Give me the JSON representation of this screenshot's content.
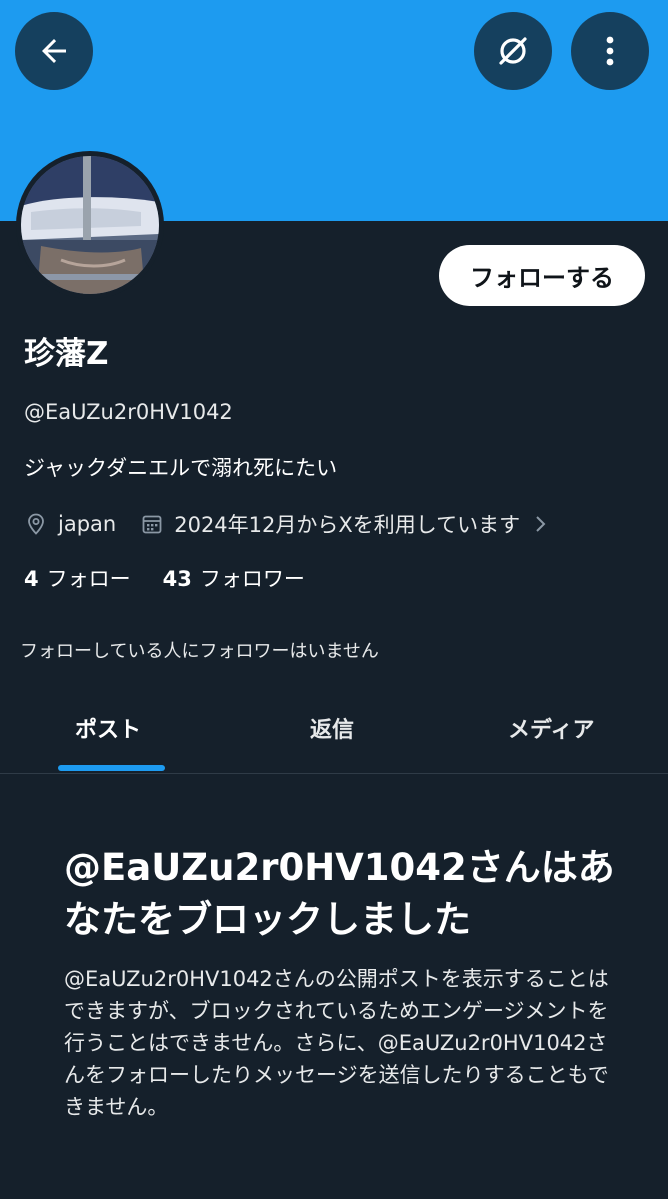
{
  "profile": {
    "display_name": "珍藩Z",
    "handle": "@EaUZu2r0HV1042",
    "bio": "ジャックダニエルで溺れ死にたい",
    "location": "japan",
    "joined": "2024年12月からXを利用しています",
    "following_count": "4",
    "following_label": "フォロー",
    "followers_count": "43",
    "followers_label": "フォロワー",
    "followers_note": "フォローしている人にフォロワーはいません"
  },
  "actions": {
    "follow_label": "フォローする"
  },
  "tabs": [
    {
      "label": "ポスト",
      "active": true
    },
    {
      "label": "返信",
      "active": false
    },
    {
      "label": "メディア",
      "active": false
    }
  ],
  "blocked": {
    "title": "@EaUZu2r0HV1042さんはあなたをブロックしました",
    "body": "@EaUZu2r0HV1042さんの公開ポストを表示することはできますが、ブロックされているためエンゲージメントを行うことはできません。さらに、@EaUZu2r0HV1042さんをフォローしたりメッセージを送信したりすることもできません。"
  },
  "icons": {
    "back": "back-arrow-icon",
    "grok": "grok-icon",
    "more": "more-vertical-icon",
    "location": "location-pin-icon",
    "calendar": "calendar-icon",
    "chevron": "chevron-right-icon"
  },
  "colors": {
    "banner": "#1d9bf0",
    "background": "#15202b",
    "accent": "#1d9bf0",
    "button_bg": "#ffffff"
  }
}
